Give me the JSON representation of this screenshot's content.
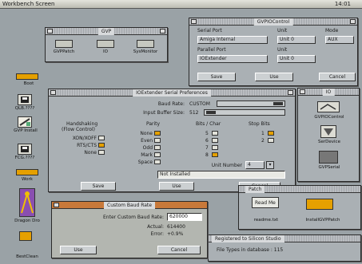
{
  "screen": {
    "title": "Workbench Screen",
    "clock": "14:01"
  },
  "desktop_icons": [
    {
      "label": "Boot"
    },
    {
      "label": "QLB.????"
    },
    {
      "label": "GVP Install"
    },
    {
      "label": "FCG.????"
    },
    {
      "label": "Work"
    },
    {
      "label": "Dragon Dro"
    },
    {
      "label": "BestClean"
    }
  ],
  "gvp_window": {
    "title": "GVP",
    "icons": [
      {
        "label": "GVPPatch"
      },
      {
        "label": "IO"
      },
      {
        "label": "SysMonitor"
      }
    ]
  },
  "gvpio_control": {
    "title": "GVPIOControl",
    "serial_port_label": "Serial Port",
    "serial_port_value": "Amiga Internal",
    "unit_label": "Unit",
    "unit_value": "Unit 0",
    "mode_label": "Mode",
    "mode_value": "AUX",
    "parallel_port_label": "Parallel Port",
    "parallel_port_value": "IOExtender",
    "parallel_unit_label": "Unit",
    "parallel_unit_value": "Unit 0",
    "save_label": "Save",
    "use_label": "Use",
    "cancel_label": "Cancel"
  },
  "io_drawer": {
    "title": "IO",
    "icons": [
      {
        "label": "GVPIOControl"
      },
      {
        "label": "SerDevice"
      },
      {
        "label": "GVPSerial"
      }
    ]
  },
  "prefs": {
    "title": "IOExtender Serial Preferences",
    "baud_rate_label": "Baud Rate:",
    "baud_rate_value": "CUSTOM",
    "buffer_label": "Input Buffer Size:",
    "buffer_value": "512",
    "handshaking_label": "Handshaking",
    "flow_control_label": "(Flow Control)",
    "handshake_options": [
      {
        "label": "XON/XOFF",
        "checked": false
      },
      {
        "label": "RTS/CTS",
        "checked": true
      },
      {
        "label": "None",
        "checked": false
      }
    ],
    "parity_label": "Parity",
    "parity_options": [
      {
        "label": "None",
        "checked": true
      },
      {
        "label": "Even",
        "checked": false
      },
      {
        "label": "Odd",
        "checked": false
      },
      {
        "label": "Mark",
        "checked": false
      },
      {
        "label": "Space",
        "checked": false
      }
    ],
    "bits_label": "Bits / Char",
    "bits_options": [
      {
        "label": "5",
        "checked": false
      },
      {
        "label": "6",
        "checked": false
      },
      {
        "label": "7",
        "checked": false
      },
      {
        "label": "8",
        "checked": true
      }
    ],
    "stop_label": "Stop Bits",
    "stop_options": [
      {
        "label": "1",
        "checked": true
      },
      {
        "label": "2",
        "checked": false
      }
    ],
    "board_label": "Unit Number",
    "board_value": "4",
    "status": "Not Installed",
    "save_label": "Save",
    "use_label": "Use",
    "cancel_label": "Cancel"
  },
  "custom_baud": {
    "title": "Custom Baud Rate",
    "enter_label": "Enter Custom Baud Rate:",
    "enter_value": "620000",
    "actual_label": "Actual:",
    "actual_value": "614400",
    "error_label": "Error:",
    "error_value": "+0.9%",
    "use_label": "Use",
    "cancel_label": "Cancel"
  },
  "patch_window": {
    "title": "Patch",
    "icons": [
      {
        "label": "readme.txt"
      },
      {
        "label": "InstallGVPPatch"
      }
    ],
    "readme_label": "Read Me"
  },
  "status_window": {
    "title": "Registered to Silicon Studio",
    "text": "File Types in database : 115"
  },
  "colors": {
    "accent": "#e5a000",
    "desktop": "#9aa2a6",
    "window": "#aab0b4"
  }
}
